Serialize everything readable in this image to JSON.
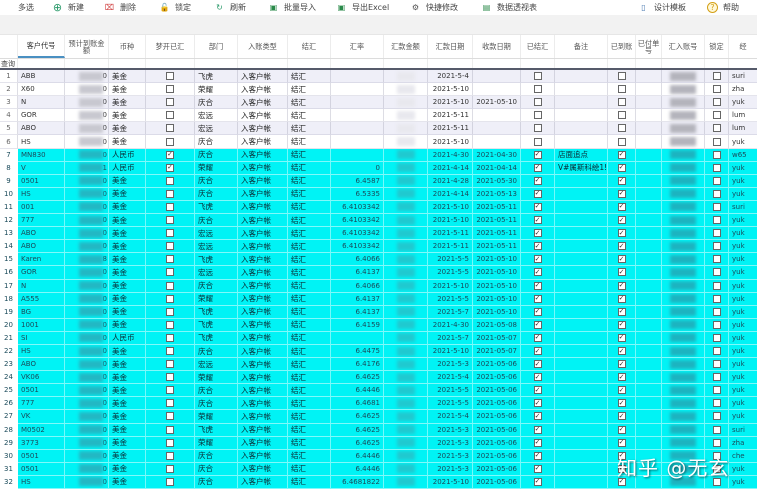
{
  "toolbar": {
    "items": [
      {
        "label": "多选",
        "icon": ""
      },
      {
        "label": "新建",
        "icon": "plus-circle-icon"
      },
      {
        "label": "删除",
        "icon": "delete-icon"
      },
      {
        "label": "锁定",
        "icon": "lock-icon"
      },
      {
        "label": "刷新",
        "icon": "refresh-icon"
      },
      {
        "label": "批量导入",
        "icon": "excel-import-icon"
      },
      {
        "label": "导出Excel",
        "icon": "excel-export-icon"
      },
      {
        "label": "快捷修改",
        "icon": "gear-icon"
      },
      {
        "label": "数据透视表",
        "icon": "pivot-table-icon"
      },
      {
        "label": "设计模板",
        "icon": "template-icon"
      },
      {
        "label": "帮助",
        "icon": "help-icon"
      }
    ]
  },
  "colors": {
    "highlight_row": "#00f3f5",
    "alt_row": "#efeff8",
    "active_header_underline": "#4a90c2"
  },
  "grid": {
    "query_label": "查询",
    "columns": [
      "客户代号",
      "预计到账金额",
      "币种",
      "梦开已汇",
      "部门",
      "入账类型",
      "结汇",
      "汇率",
      "汇款金额",
      "汇款日期",
      "收款日期",
      "已结汇",
      "备注",
      "已到账",
      "已付单号",
      "汇入账号",
      "锁定",
      "经"
    ],
    "rows": [
      {
        "n": "1",
        "code": "ABB",
        "amt": "0",
        "cur": "美金",
        "paid": false,
        "dept": "飞虎",
        "type": "入客户帐",
        "fx": "结汇",
        "rate": "",
        "rdate": "2021-5-4",
        "cdate": "",
        "settled": false,
        "note": "",
        "arrived": false,
        "locked": false,
        "user": "suri",
        "style": "lav"
      },
      {
        "n": "2",
        "code": "X60",
        "amt": "0",
        "cur": "美金",
        "paid": false,
        "dept": "荣耀",
        "type": "入客户帐",
        "fx": "结汇",
        "rate": "",
        "rdate": "2021-5-10",
        "cdate": "",
        "settled": false,
        "note": "",
        "arrived": false,
        "locked": false,
        "user": "zha",
        "style": "white"
      },
      {
        "n": "3",
        "code": "N",
        "amt": "0",
        "cur": "美金",
        "paid": false,
        "dept": "庆合",
        "type": "入客户帐",
        "fx": "结汇",
        "rate": "",
        "rdate": "2021-5-10",
        "cdate": "2021-05-10",
        "settled": false,
        "note": "",
        "arrived": false,
        "locked": false,
        "user": "yuk",
        "style": "lav"
      },
      {
        "n": "4",
        "code": "GOR",
        "amt": "0",
        "cur": "美金",
        "paid": false,
        "dept": "宏远",
        "type": "入客户帐",
        "fx": "结汇",
        "rate": "",
        "rdate": "2021-5-11",
        "cdate": "",
        "settled": false,
        "note": "",
        "arrived": false,
        "locked": false,
        "user": "lum",
        "style": "white"
      },
      {
        "n": "5",
        "code": "ABO",
        "amt": "0",
        "cur": "美金",
        "paid": false,
        "dept": "宏远",
        "type": "入客户帐",
        "fx": "结汇",
        "rate": "",
        "rdate": "2021-5-11",
        "cdate": "",
        "settled": false,
        "note": "",
        "arrived": false,
        "locked": false,
        "user": "lum",
        "style": "lav"
      },
      {
        "n": "6",
        "code": "HS",
        "amt": "0",
        "cur": "美金",
        "paid": false,
        "dept": "庆合",
        "type": "入客户帐",
        "fx": "结汇",
        "rate": "",
        "rdate": "2021-5-10",
        "cdate": "",
        "settled": false,
        "note": "",
        "arrived": false,
        "locked": false,
        "user": "yuk",
        "style": "white"
      },
      {
        "n": "7",
        "code": "MN830",
        "amt": "0",
        "cur": "人民币",
        "paid": true,
        "dept": "庆合",
        "type": "入客户帐",
        "fx": "结汇",
        "rate": "",
        "rdate": "2021-4-30",
        "cdate": "2021-04-30",
        "settled": true,
        "note": "店面追点",
        "arrived": true,
        "locked": false,
        "user": "w65",
        "style": "cyan"
      },
      {
        "n": "8",
        "code": "V",
        "amt": "1",
        "cur": "人民币",
        "paid": true,
        "dept": "荣耀",
        "type": "入客户帐",
        "fx": "结汇",
        "rate": "0",
        "rdate": "2021-4-14",
        "cdate": "2021-04-14",
        "settled": true,
        "note": "V#属斯科絵1!",
        "arrived": true,
        "locked": false,
        "user": "yuk",
        "style": "cyan"
      },
      {
        "n": "9",
        "code": "0501",
        "amt": "0",
        "cur": "美金",
        "paid": false,
        "dept": "庆合",
        "type": "入客户帐",
        "fx": "结汇",
        "rate": "6.4587",
        "rdate": "2021-4-28",
        "cdate": "2021-05-30",
        "settled": true,
        "note": "",
        "arrived": true,
        "locked": false,
        "user": "yuk",
        "style": "cyan"
      },
      {
        "n": "10",
        "code": "HS",
        "amt": "0",
        "cur": "美金",
        "paid": false,
        "dept": "庆合",
        "type": "入客户帐",
        "fx": "结汇",
        "rate": "6.5335",
        "rdate": "2021-4-14",
        "cdate": "2021-05-13",
        "settled": true,
        "note": "",
        "arrived": true,
        "locked": false,
        "user": "yuk",
        "style": "cyan"
      },
      {
        "n": "11",
        "code": "001",
        "amt": "0",
        "cur": "美金",
        "paid": false,
        "dept": "飞虎",
        "type": "入客户帐",
        "fx": "结汇",
        "rate": "6.4103342",
        "rdate": "2021-5-10",
        "cdate": "2021-05-11",
        "settled": true,
        "note": "",
        "arrived": true,
        "locked": false,
        "user": "suri",
        "style": "cyan"
      },
      {
        "n": "12",
        "code": "777",
        "amt": "0",
        "cur": "美金",
        "paid": false,
        "dept": "庆合",
        "type": "入客户帐",
        "fx": "结汇",
        "rate": "6.4103342",
        "rdate": "2021-5-10",
        "cdate": "2021-05-11",
        "settled": true,
        "note": "",
        "arrived": true,
        "locked": false,
        "user": "yuk",
        "style": "cyan"
      },
      {
        "n": "13",
        "code": "ABO",
        "amt": "0",
        "cur": "美金",
        "paid": false,
        "dept": "宏远",
        "type": "入客户帐",
        "fx": "结汇",
        "rate": "6.4103342",
        "rdate": "2021-5-11",
        "cdate": "2021-05-11",
        "settled": true,
        "note": "",
        "arrived": true,
        "locked": false,
        "user": "yuk",
        "style": "cyan"
      },
      {
        "n": "14",
        "code": "ABO",
        "amt": "0",
        "cur": "美金",
        "paid": false,
        "dept": "宏远",
        "type": "入客户帐",
        "fx": "结汇",
        "rate": "6.4103342",
        "rdate": "2021-5-11",
        "cdate": "2021-05-11",
        "settled": true,
        "note": "",
        "arrived": true,
        "locked": false,
        "user": "yuk",
        "style": "cyan"
      },
      {
        "n": "15",
        "code": "Karen",
        "amt": "8",
        "cur": "美金",
        "paid": false,
        "dept": "飞虎",
        "type": "入客户帐",
        "fx": "结汇",
        "rate": "6.4066",
        "rdate": "2021-5-5",
        "cdate": "2021-05-10",
        "settled": true,
        "note": "",
        "arrived": true,
        "locked": false,
        "user": "yuk",
        "style": "cyan"
      },
      {
        "n": "16",
        "code": "GOR",
        "amt": "0",
        "cur": "美金",
        "paid": false,
        "dept": "宏远",
        "type": "入客户帐",
        "fx": "结汇",
        "rate": "6.4137",
        "rdate": "2021-5-5",
        "cdate": "2021-05-10",
        "settled": true,
        "note": "",
        "arrived": true,
        "locked": false,
        "user": "yuk",
        "style": "cyan"
      },
      {
        "n": "17",
        "code": "N",
        "amt": "0",
        "cur": "美金",
        "paid": false,
        "dept": "庆合",
        "type": "入客户帐",
        "fx": "结汇",
        "rate": "6.4066",
        "rdate": "2021-5-10",
        "cdate": "2021-05-10",
        "settled": true,
        "note": "",
        "arrived": true,
        "locked": false,
        "user": "yuk",
        "style": "cyan"
      },
      {
        "n": "18",
        "code": "A555",
        "amt": "0",
        "cur": "美金",
        "paid": false,
        "dept": "荣耀",
        "type": "入客户帐",
        "fx": "结汇",
        "rate": "6.4137",
        "rdate": "2021-5-5",
        "cdate": "2021-05-10",
        "settled": true,
        "note": "",
        "arrived": true,
        "locked": false,
        "user": "yuk",
        "style": "cyan"
      },
      {
        "n": "19",
        "code": "BG",
        "amt": "0",
        "cur": "美金",
        "paid": false,
        "dept": "飞虎",
        "type": "入客户帐",
        "fx": "结汇",
        "rate": "6.4137",
        "rdate": "2021-5-7",
        "cdate": "2021-05-10",
        "settled": true,
        "note": "",
        "arrived": true,
        "locked": false,
        "user": "yuk",
        "style": "cyan"
      },
      {
        "n": "20",
        "code": "1001",
        "amt": "0",
        "cur": "美金",
        "paid": false,
        "dept": "飞虎",
        "type": "入客户帐",
        "fx": "结汇",
        "rate": "6.4159",
        "rdate": "2021-4-30",
        "cdate": "2021-05-08",
        "settled": true,
        "note": "",
        "arrived": true,
        "locked": false,
        "user": "yuk",
        "style": "cyan"
      },
      {
        "n": "21",
        "code": "SI",
        "amt": "0",
        "cur": "人民币",
        "paid": false,
        "dept": "飞虎",
        "type": "入客户帐",
        "fx": "结汇",
        "rate": "",
        "rdate": "2021-5-7",
        "cdate": "2021-05-07",
        "settled": true,
        "note": "",
        "arrived": true,
        "locked": false,
        "user": "yuk",
        "style": "cyan"
      },
      {
        "n": "22",
        "code": "HS",
        "amt": "0",
        "cur": "美金",
        "paid": false,
        "dept": "庆合",
        "type": "入客户帐",
        "fx": "结汇",
        "rate": "6.4475",
        "rdate": "2021-5-10",
        "cdate": "2021-05-07",
        "settled": true,
        "note": "",
        "arrived": true,
        "locked": false,
        "user": "yuk",
        "style": "cyan"
      },
      {
        "n": "23",
        "code": "ABO",
        "amt": "0",
        "cur": "美金",
        "paid": false,
        "dept": "宏远",
        "type": "入客户帐",
        "fx": "结汇",
        "rate": "6.4176",
        "rdate": "2021-5-3",
        "cdate": "2021-05-06",
        "settled": true,
        "note": "",
        "arrived": true,
        "locked": false,
        "user": "yuk",
        "style": "cyan"
      },
      {
        "n": "24",
        "code": "VK06",
        "amt": "0",
        "cur": "美金",
        "paid": false,
        "dept": "荣耀",
        "type": "入客户帐",
        "fx": "结汇",
        "rate": "6.4625",
        "rdate": "2021-5-4",
        "cdate": "2021-05-06",
        "settled": true,
        "note": "",
        "arrived": true,
        "locked": false,
        "user": "yuk",
        "style": "cyan"
      },
      {
        "n": "25",
        "code": "0501",
        "amt": "0",
        "cur": "美金",
        "paid": false,
        "dept": "庆合",
        "type": "入客户帐",
        "fx": "结汇",
        "rate": "6.4446",
        "rdate": "2021-5-5",
        "cdate": "2021-05-06",
        "settled": true,
        "note": "",
        "arrived": true,
        "locked": false,
        "user": "yuk",
        "style": "cyan"
      },
      {
        "n": "26",
        "code": "777",
        "amt": "0",
        "cur": "美金",
        "paid": false,
        "dept": "庆合",
        "type": "入客户帐",
        "fx": "结汇",
        "rate": "6.4681",
        "rdate": "2021-5-5",
        "cdate": "2021-05-06",
        "settled": true,
        "note": "",
        "arrived": true,
        "locked": false,
        "user": "yuk",
        "style": "cyan"
      },
      {
        "n": "27",
        "code": "VK",
        "amt": "0",
        "cur": "美金",
        "paid": false,
        "dept": "荣耀",
        "type": "入客户帐",
        "fx": "结汇",
        "rate": "6.4625",
        "rdate": "2021-5-4",
        "cdate": "2021-05-06",
        "settled": true,
        "note": "",
        "arrived": true,
        "locked": false,
        "user": "yuk",
        "style": "cyan"
      },
      {
        "n": "28",
        "code": "M0502",
        "amt": "0",
        "cur": "美金",
        "paid": false,
        "dept": "飞虎",
        "type": "入客户帐",
        "fx": "结汇",
        "rate": "6.4625",
        "rdate": "2021-5-3",
        "cdate": "2021-05-06",
        "settled": true,
        "note": "",
        "arrived": true,
        "locked": false,
        "user": "suri",
        "style": "cyan"
      },
      {
        "n": "29",
        "code": "3773",
        "amt": "0",
        "cur": "美金",
        "paid": false,
        "dept": "荣耀",
        "type": "入客户帐",
        "fx": "结汇",
        "rate": "6.4625",
        "rdate": "2021-5-3",
        "cdate": "2021-05-06",
        "settled": true,
        "note": "",
        "arrived": true,
        "locked": false,
        "user": "zha",
        "style": "cyan"
      },
      {
        "n": "30",
        "code": "0501",
        "amt": "0",
        "cur": "美金",
        "paid": false,
        "dept": "庆合",
        "type": "入客户帐",
        "fx": "结汇",
        "rate": "6.4446",
        "rdate": "2021-5-3",
        "cdate": "2021-05-06",
        "settled": true,
        "note": "",
        "arrived": true,
        "locked": false,
        "user": "che",
        "style": "cyan"
      },
      {
        "n": "31",
        "code": "0501",
        "amt": "0",
        "cur": "美金",
        "paid": false,
        "dept": "庆合",
        "type": "入客户帐",
        "fx": "结汇",
        "rate": "6.4446",
        "rdate": "2021-5-3",
        "cdate": "2021-05-06",
        "settled": true,
        "note": "",
        "arrived": true,
        "locked": false,
        "user": "yuk",
        "style": "cyan"
      },
      {
        "n": "32",
        "code": "HS",
        "amt": "0",
        "cur": "美金",
        "paid": false,
        "dept": "庆合",
        "type": "入客户帐",
        "fx": "结汇",
        "rate": "6.4681822",
        "rdate": "2021-5-10",
        "cdate": "2021-05-06",
        "settled": true,
        "note": "",
        "arrived": true,
        "locked": false,
        "user": "yuk",
        "style": "cyan"
      }
    ]
  },
  "watermark": "知乎 @无玄"
}
